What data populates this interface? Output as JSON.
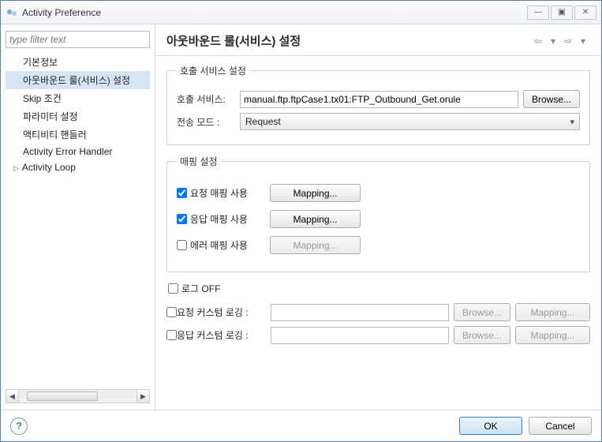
{
  "window": {
    "title": "Activity Preference"
  },
  "filter_placeholder": "type filter text",
  "tree": {
    "items": [
      {
        "label": "기본정보"
      },
      {
        "label": "아웃바운드 룰(서비스) 설정",
        "selected": true
      },
      {
        "label": "Skip 조건"
      },
      {
        "label": "파라미터 설정"
      },
      {
        "label": "액티비티 핸들러"
      },
      {
        "label": "Activity Error Handler"
      },
      {
        "label": "Activity Loop",
        "caret": true
      }
    ]
  },
  "header": {
    "title": "아웃바운드 룰(서비스) 설정"
  },
  "call_service": {
    "legend": "호출 서비스 설정",
    "service_label": "호출 서비스:",
    "service_value": "manual.ftp.ftpCase1.tx01:FTP_Outbound_Get.orule",
    "browse": "Browse...",
    "mode_label": "전송 모드 :",
    "mode_value": "Request"
  },
  "mapping": {
    "legend": "매핑 설정",
    "req_label": "요청 매핑 사용",
    "res_label": "응답 매핑 사용",
    "err_label": "에러 매핑 사용",
    "mapping_btn": "Mapping...",
    "req_checked": true,
    "res_checked": true,
    "err_checked": false
  },
  "log_off_label": "로그 OFF",
  "custom_req_label": "요청 커스텀 로깅 :",
  "custom_res_label": "응답 커스텀 로깅 :",
  "browse_btn": "Browse...",
  "mapping_btn": "Mapping...",
  "buttons": {
    "ok": "OK",
    "cancel": "Cancel"
  }
}
